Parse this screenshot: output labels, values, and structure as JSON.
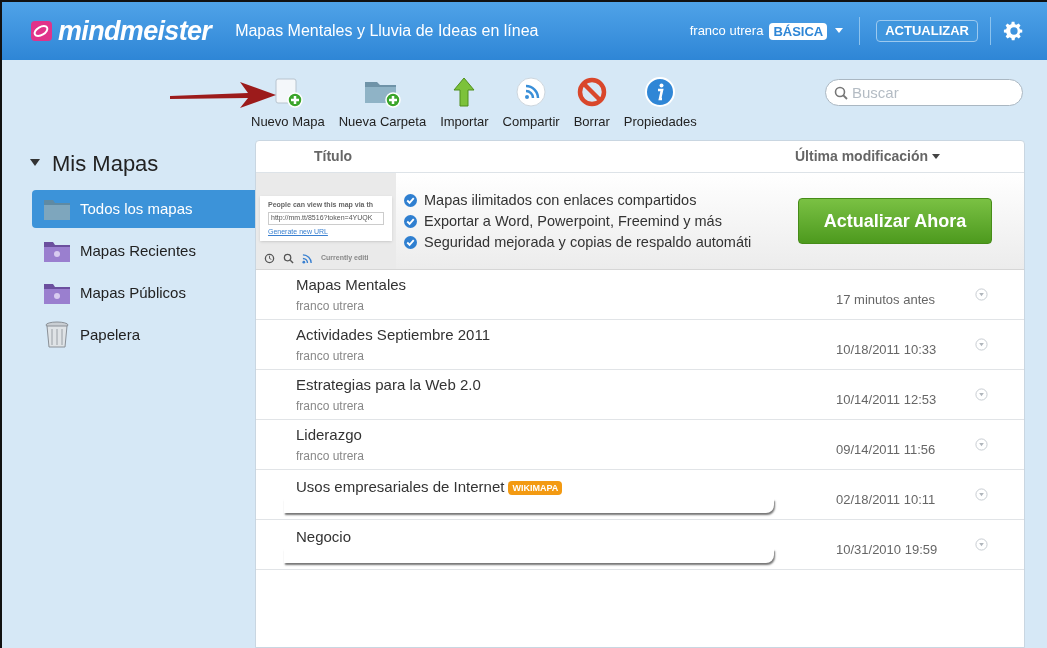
{
  "header": {
    "logo": "mindmeister",
    "tagline": "Mapas Mentales y Lluvia de Ideas en línea",
    "user": "franco utrera",
    "plan": "BÁSICA",
    "upgrade": "ACTUALIZAR"
  },
  "toolbar": [
    {
      "kind": "new-map",
      "label": "Nuevo Mapa"
    },
    {
      "kind": "new-folder",
      "label": "Nueva Carpeta"
    },
    {
      "kind": "import",
      "label": "Importar"
    },
    {
      "kind": "share",
      "label": "Compartir"
    },
    {
      "kind": "delete",
      "label": "Borrar"
    },
    {
      "kind": "info",
      "label": "Propiedades"
    }
  ],
  "search": {
    "placeholder": "Buscar"
  },
  "sidebar": {
    "title": "Mis Mapas",
    "expanded": true,
    "items": [
      {
        "kind": "folder",
        "label": "Todos los mapas",
        "selected": true
      },
      {
        "kind": "purple-folder",
        "label": "Mapas Recientes",
        "selected": false
      },
      {
        "kind": "purple-folder",
        "label": "Mapas Públicos",
        "selected": false
      },
      {
        "kind": "trash",
        "label": "Papelera",
        "selected": false
      }
    ]
  },
  "table": {
    "columns": [
      "Título",
      "Última modificación"
    ],
    "promo": {
      "preview": {
        "checkbox_label": "People can view this map via th",
        "url": "http://mm.tt/8516?token=4YUQK",
        "link": "Generate new URL",
        "status": "Currently editi"
      },
      "features": [
        "Mapas ilimitados con enlaces compartidos",
        "Exportar a Word, Powerpoint, Freemind y más",
        "Seguridad mejorada y copias de respaldo automáti"
      ],
      "button": "Actualizar Ahora"
    },
    "rows": [
      {
        "title": "Mapas Mentales",
        "owner": "franco utrera",
        "modified": "17 minutos antes"
      },
      {
        "title": "Actividades Septiembre 2011",
        "owner": "franco utrera",
        "modified": "10/18/2011 10:33"
      },
      {
        "title": "Estrategias para la Web 2.0",
        "owner": "franco utrera",
        "modified": "10/14/2011 12:53"
      },
      {
        "title": "Liderazgo",
        "owner": "franco utrera",
        "modified": "09/14/2011 11:56"
      },
      {
        "title": "Usos empresariales de Internet",
        "badge": "WIKIMAPA",
        "redacted": true,
        "modified": "02/18/2011 10:11"
      },
      {
        "title": "Negocio",
        "redacted": true,
        "modified": "10/31/2010 19:59"
      }
    ]
  }
}
